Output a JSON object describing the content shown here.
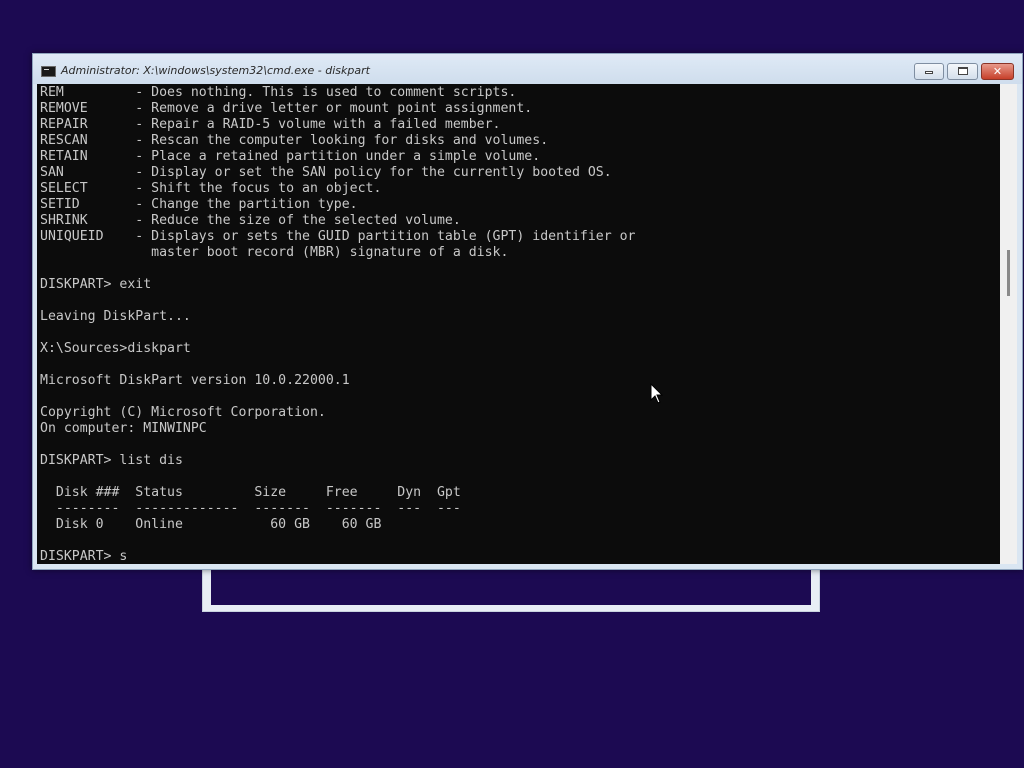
{
  "window": {
    "title": "Administrator: X:\\windows\\system32\\cmd.exe - diskpart",
    "minimize_glyph": "minimize",
    "maximize_glyph": "maximize",
    "close_glyph": "✕"
  },
  "console": {
    "lines": [
      "REM         - Does nothing. This is used to comment scripts.",
      "REMOVE      - Remove a drive letter or mount point assignment.",
      "REPAIR      - Repair a RAID-5 volume with a failed member.",
      "RESCAN      - Rescan the computer looking for disks and volumes.",
      "RETAIN      - Place a retained partition under a simple volume.",
      "SAN         - Display or set the SAN policy for the currently booted OS.",
      "SELECT      - Shift the focus to an object.",
      "SETID       - Change the partition type.",
      "SHRINK      - Reduce the size of the selected volume.",
      "UNIQUEID    - Displays or sets the GUID partition table (GPT) identifier or",
      "              master boot record (MBR) signature of a disk.",
      "",
      "DISKPART> exit",
      "",
      "Leaving DiskPart...",
      "",
      "X:\\Sources>diskpart",
      "",
      "Microsoft DiskPart version 10.0.22000.1",
      "",
      "Copyright (C) Microsoft Corporation.",
      "On computer: MINWINPC",
      "",
      "DISKPART> list dis",
      "",
      "  Disk ###  Status         Size     Free     Dyn  Gpt",
      "  --------  -------------  -------  -------  ---  ---",
      "  Disk 0    Online           60 GB    60 GB",
      "",
      "DISKPART> s"
    ]
  },
  "colors": {
    "desktop_background": "#1c0a52",
    "console_background": "#0c0c0c",
    "console_text": "#c8c8c8",
    "close_button": "#c7402a"
  }
}
